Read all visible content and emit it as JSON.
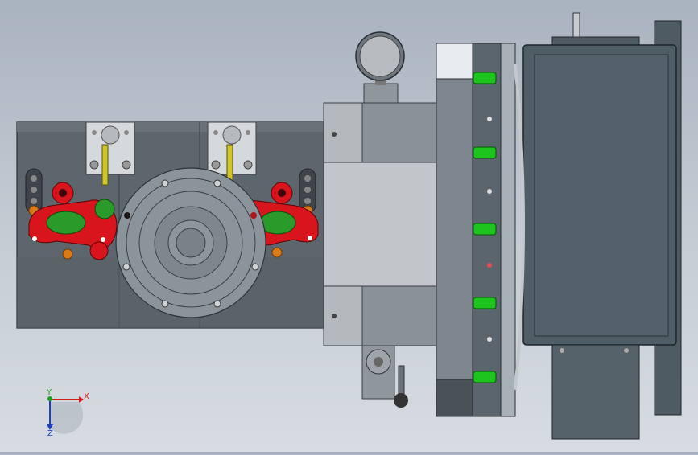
{
  "view": {
    "type": "cad-3d-model-viewport",
    "background_colors": [
      "#a9b3bf",
      "#d7dce2"
    ],
    "colors": {
      "body_dark": "#5c646c",
      "body_mid": "#7d868e",
      "body_light": "#b9bec3",
      "bracket_red": "#d8141c",
      "pin_green": "#1ec41e",
      "part_green": "#2a9a2a",
      "rod_yellow": "#c9c12a",
      "nut_orange": "#d77a17",
      "motor_slate": "#4f5d66"
    }
  },
  "triad": {
    "x_label": "X",
    "y_label": "Y",
    "z_label": "Z",
    "x_color": "#d22020",
    "y_color": "#20a020",
    "z_color": "#1f3fbf"
  }
}
